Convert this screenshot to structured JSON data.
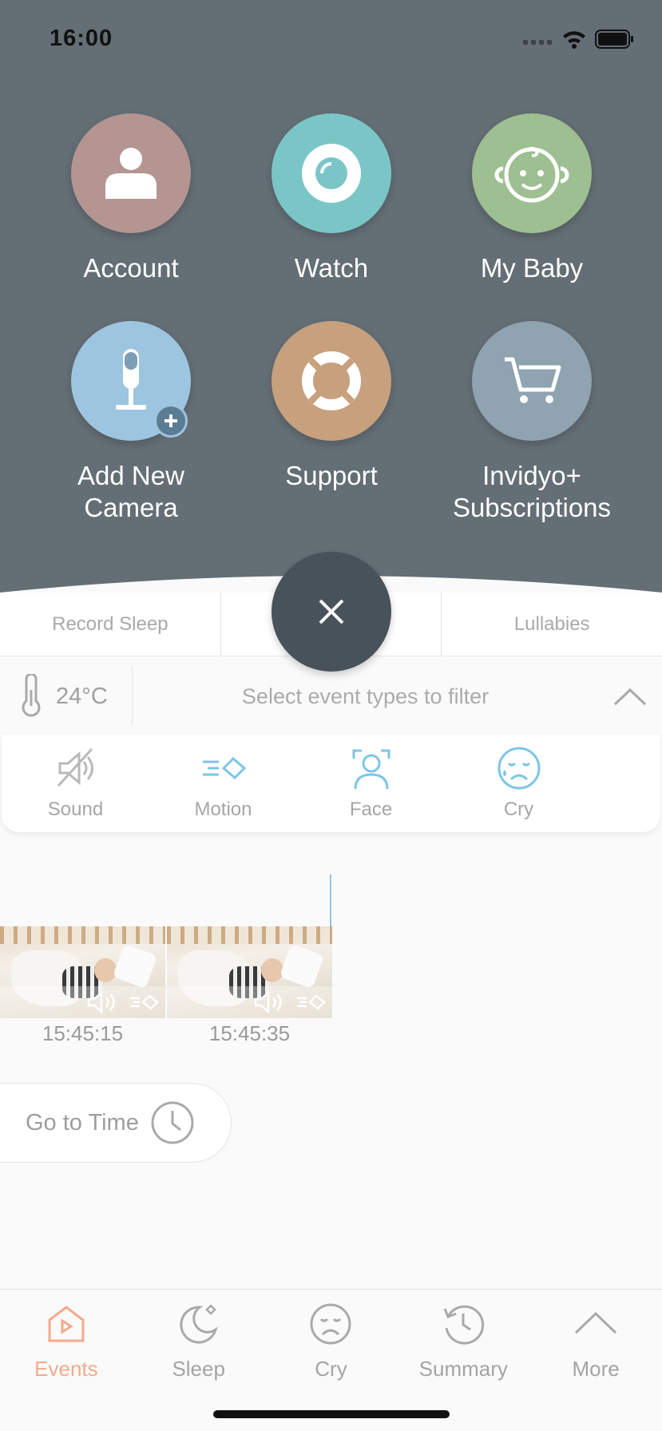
{
  "status_bar": {
    "time": "16:00"
  },
  "menu": {
    "items": [
      {
        "label": "Account",
        "icon": "person-icon",
        "color": "#b49592"
      },
      {
        "label": "Watch",
        "icon": "camera-lens-icon",
        "color": "#7ac6c6"
      },
      {
        "label": "My Baby",
        "icon": "baby-face-icon",
        "color": "#9dbf91"
      },
      {
        "label": "Add New Camera",
        "icon": "camera-stand-icon",
        "color": "#9ec5e0"
      },
      {
        "label": "Support",
        "icon": "lifebuoy-icon",
        "color": "#c7a07d"
      },
      {
        "label": "Invidyo+ Subscriptions",
        "icon": "cart-icon",
        "color": "#8fa3b0"
      }
    ],
    "background_color": "#646e75"
  },
  "tabs_strip": {
    "left": "Record Sleep",
    "right": "Lullabies"
  },
  "filter": {
    "temperature": "24°C",
    "prompt": "Select event types to filter",
    "event_types": [
      "Sound",
      "Motion",
      "Face",
      "Cry"
    ]
  },
  "events": [
    {
      "time": "15:45:15"
    },
    {
      "time": "15:45:35"
    }
  ],
  "goto_time": {
    "label": "Go to Time"
  },
  "bottom_nav": {
    "items": [
      "Events",
      "Sleep",
      "Cry",
      "Summary",
      "More"
    ],
    "active": "Events",
    "active_color": "#f4a98c"
  }
}
